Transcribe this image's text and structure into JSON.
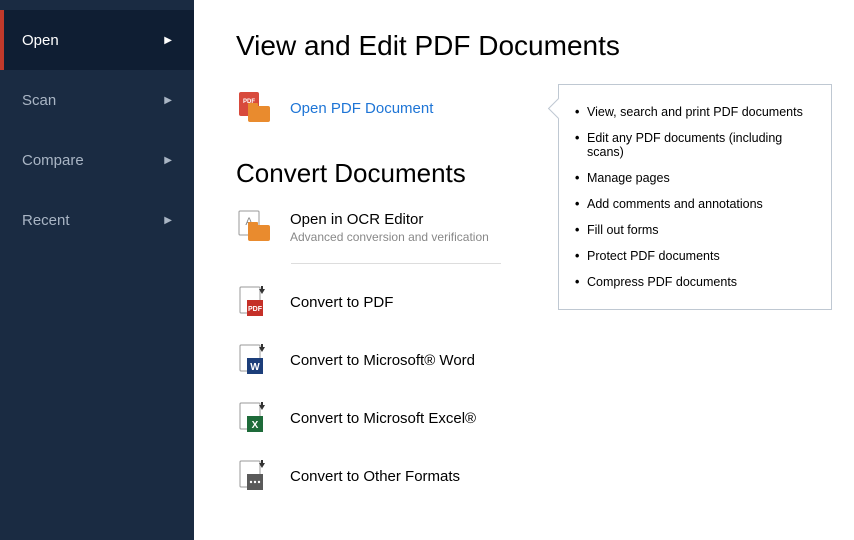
{
  "sidebar": {
    "items": [
      {
        "label": "Open",
        "active": true
      },
      {
        "label": "Scan",
        "active": false
      },
      {
        "label": "Compare",
        "active": false
      },
      {
        "label": "Recent",
        "active": false
      }
    ]
  },
  "main": {
    "heading1": "View and Edit PDF Documents",
    "open_pdf": {
      "title": "Open PDF Document"
    },
    "heading2": "Convert Documents",
    "ocr_editor": {
      "title": "Open in OCR Editor",
      "sub": "Advanced conversion and verification"
    },
    "convert": [
      {
        "title": "Convert to PDF"
      },
      {
        "title": "Convert to Microsoft® Word"
      },
      {
        "title": "Convert to Microsoft Excel®"
      },
      {
        "title": "Convert to Other Formats"
      }
    ]
  },
  "info": {
    "items": [
      "View, search and print PDF documents",
      "Edit any PDF documents (including scans)",
      "Manage pages",
      "Add comments and annotations",
      "Fill out forms",
      "Protect PDF documents",
      "Compress PDF documents"
    ]
  }
}
